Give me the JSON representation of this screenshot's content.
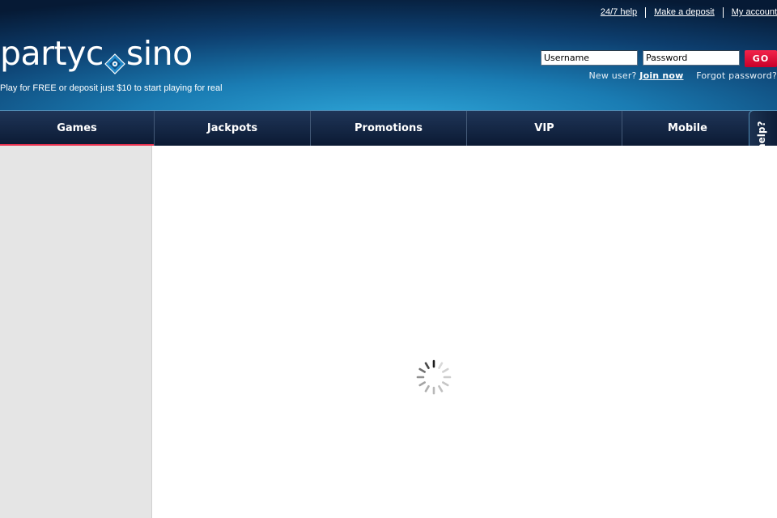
{
  "header": {
    "top_links": [
      "24/7 help",
      "Make a deposit",
      "My account"
    ],
    "logo_text_left": "partyc",
    "logo_text_right": "sino",
    "tagline": "Play for FREE or deposit just $10 to start playing for real"
  },
  "login": {
    "username_placeholder": "Username",
    "password_placeholder": "Password",
    "go_label": "GO",
    "new_user_label": "New user?",
    "join_label": "Join now",
    "forgot_label": "Forgot password?"
  },
  "nav": {
    "tabs": [
      "Games",
      "Jackpots",
      "Promotions",
      "VIP",
      "Mobile"
    ],
    "active": "Games"
  },
  "help_tab": {
    "label": "Need help?"
  },
  "colors": {
    "accent_red": "#e8324f",
    "go_button": "#d9002f",
    "nav_bg": "#0f2040",
    "header_blue": "#1a7cb3"
  },
  "icons": {
    "logo_chip": "casino-chip-icon",
    "loader": "loading-spinner-icon"
  }
}
